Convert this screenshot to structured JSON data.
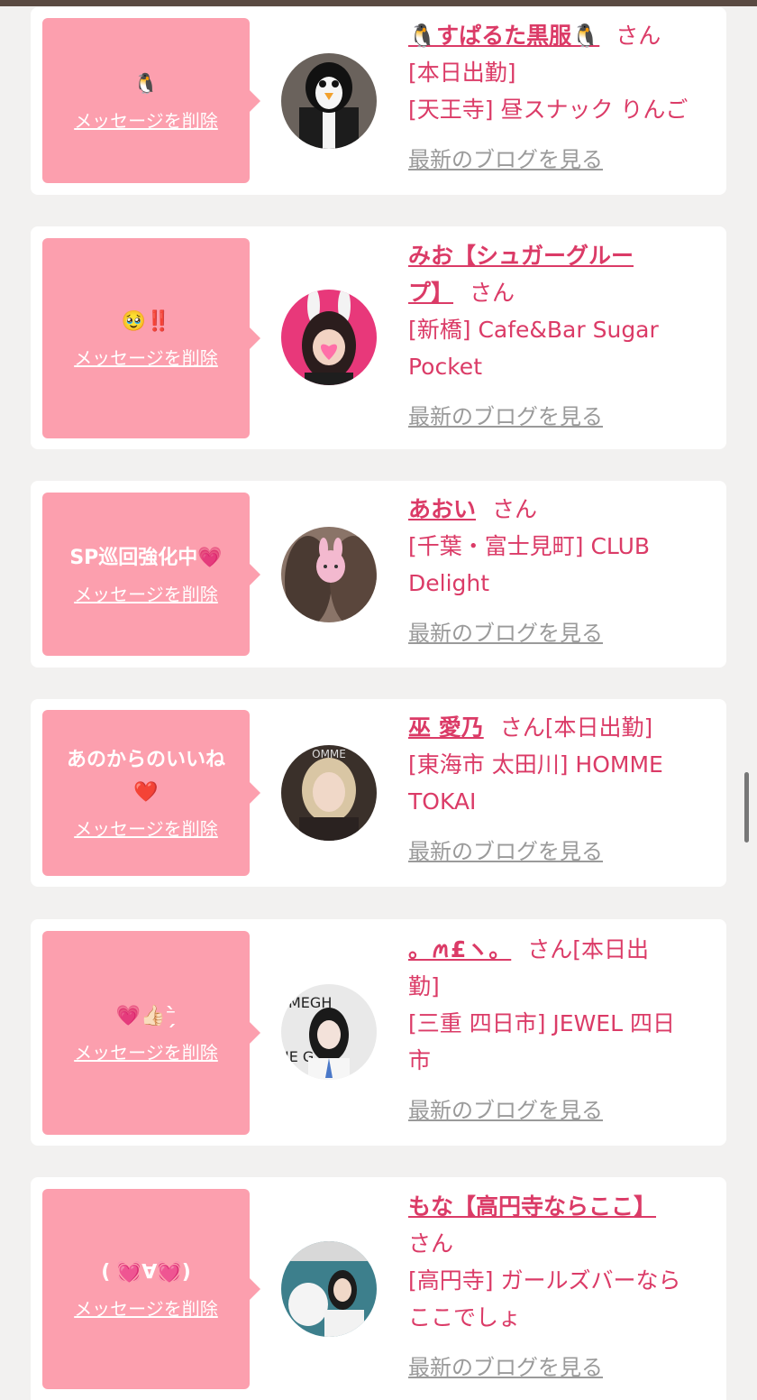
{
  "delete_label": "メッセージを削除",
  "blog_label": "最新のブログを見る",
  "san_label": "さん",
  "cards": [
    {
      "message": "🐧",
      "name": "🐧すぱるた黒服🐧",
      "lines": [
        "[本日出勤]",
        "[天王寺] 昼スナック りんご"
      ]
    },
    {
      "message": "🥹‼️",
      "name_lines": [
        "みお【シュガーグルー",
        "プ】"
      ],
      "lines": [
        "[新橋] Cafe&Bar Sugar",
        "Pocket"
      ]
    },
    {
      "message": "SP巡回強化中💗",
      "name": "あおい",
      "lines": [
        "[千葉・富士見町] CLUB",
        "Delight"
      ]
    },
    {
      "message_lines": [
        "あのからのいいね",
        "❤️"
      ],
      "name": "巫 愛乃",
      "name_suffix": "さん[本日出勤]",
      "lines": [
        "[東海市 太田川] HOMME",
        "TOKAI"
      ]
    },
    {
      "message": "💗👍🏻⁻̗̀",
      "name": "。ꪔ£ヽ。",
      "name_suffix": "さん[本日出",
      "lines": [
        "勤]",
        "[三重 四日市] JEWEL 四日",
        "市"
      ]
    },
    {
      "message": "( 💓∀💓)",
      "name": "もな【高円寺ならここ】",
      "lines": [
        "さん",
        "[高円寺] ガールズバーなら",
        "ここでしょ"
      ]
    }
  ],
  "colors": {
    "background": "#f2f1f0",
    "bubble": "#fc9fae",
    "accent": "#db3b67",
    "muted": "#9a9a9a"
  }
}
